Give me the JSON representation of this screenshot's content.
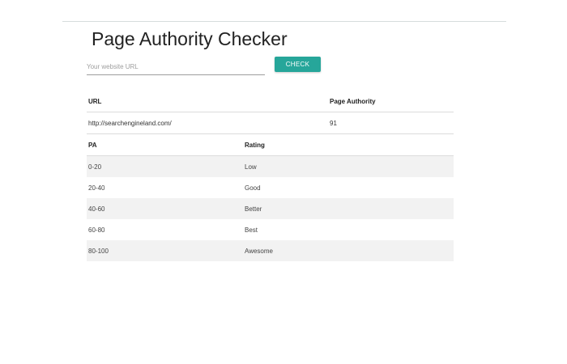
{
  "page": {
    "title": "Page Authority Checker"
  },
  "form": {
    "url_placeholder": "Your website URL",
    "url_value": "",
    "check_label": "CHECK"
  },
  "colors": {
    "accent": "#26a69a",
    "stripe": "#f2f2f2",
    "rule": "#d6dcdc"
  },
  "result": {
    "headers": {
      "url": "URL",
      "page_authority": "Page Authority"
    },
    "rows": [
      {
        "url": "http://searchengineland.com/",
        "page_authority": "91"
      }
    ]
  },
  "rating": {
    "headers": {
      "pa": "PA",
      "rating": "Rating"
    },
    "rows": [
      {
        "range": "0-20",
        "label": "Low"
      },
      {
        "range": "20-40",
        "label": "Good"
      },
      {
        "range": "40-60",
        "label": "Better"
      },
      {
        "range": "60-80",
        "label": "Best"
      },
      {
        "range": "80-100",
        "label": "Awesome"
      }
    ]
  }
}
